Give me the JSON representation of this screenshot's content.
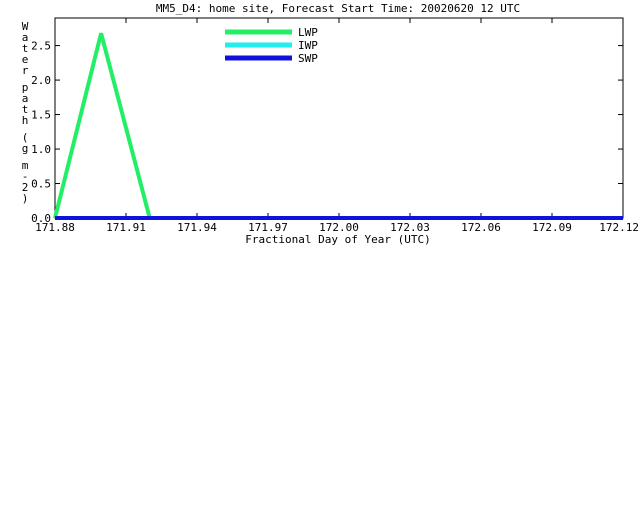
{
  "chart_data": {
    "type": "line",
    "title": "MM5_D4: home site,  Forecast Start Time: 20020620 12 UTC",
    "xlabel": "Fractional Day of Year (UTC)",
    "ylabel": "Water path (g m-2)",
    "xlim": [
      171.88,
      172.12
    ],
    "ylim": [
      0.0,
      2.9
    ],
    "xticks": [
      "171.88",
      "171.91",
      "171.94",
      "171.97",
      "172.00",
      "172.03",
      "172.06",
      "172.09",
      "172.12"
    ],
    "yticks": [
      "0.0",
      "0.5",
      "1.0",
      "1.5",
      "2.0",
      "2.5"
    ],
    "legend_position": "top-center",
    "series": [
      {
        "name": "LWP",
        "color": "#22ee66",
        "x": [
          171.88,
          171.8995,
          171.92,
          172.12
        ],
        "y": [
          0.0,
          2.68,
          0.0,
          0.0
        ]
      },
      {
        "name": "IWP",
        "color": "#22eeee",
        "x": [
          171.88,
          172.12
        ],
        "y": [
          0.0,
          0.0
        ]
      },
      {
        "name": "SWP",
        "color": "#1111dd",
        "x": [
          171.88,
          172.12
        ],
        "y": [
          0.0,
          0.0
        ]
      }
    ]
  }
}
